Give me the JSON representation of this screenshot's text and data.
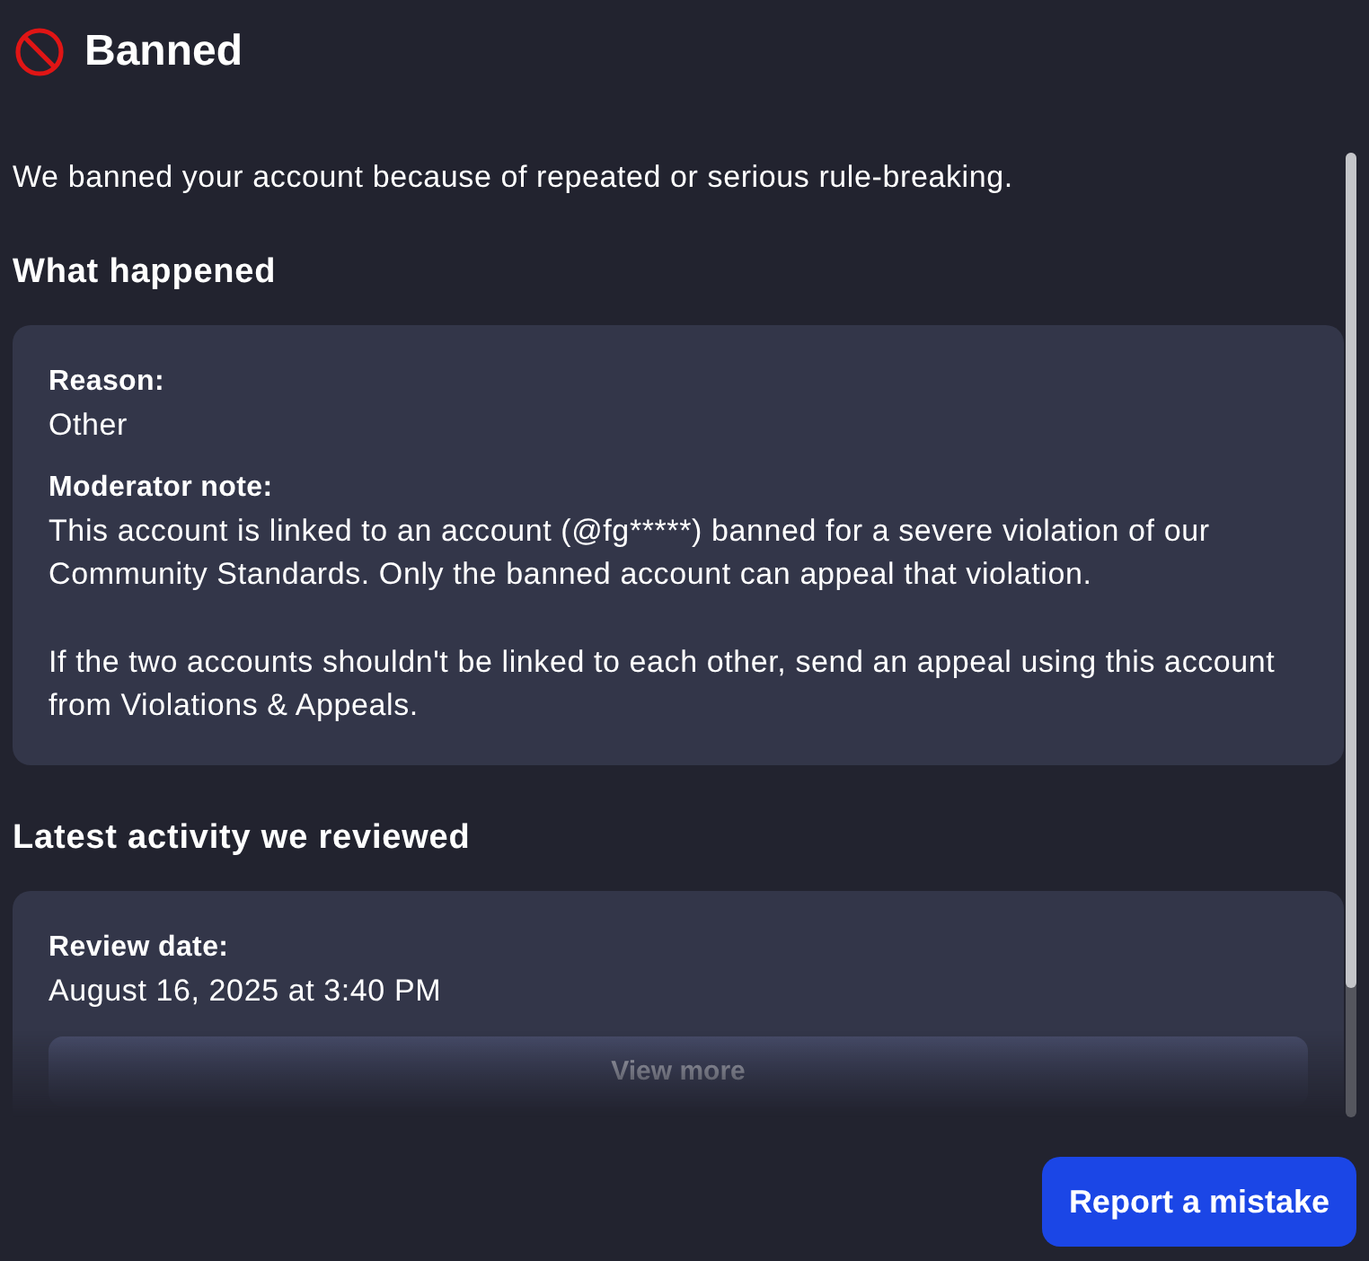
{
  "header": {
    "title": "Banned"
  },
  "summary": "We banned your account because of repeated or serious rule-breaking.",
  "sections": [
    {
      "heading": "What happened",
      "fields": [
        {
          "label": "Reason:",
          "paragraphs": [
            "Other"
          ]
        },
        {
          "label": "Moderator note:",
          "paragraphs": [
            "This account is linked to an account (@fg*****) banned for a severe violation of our Community Standards. Only the banned account can appeal that violation.",
            "If the two accounts shouldn't be linked to each other, send an appeal using this account from Violations & Appeals."
          ]
        }
      ]
    },
    {
      "heading": "Latest activity we reviewed",
      "fields": [
        {
          "label": "Review date:",
          "paragraphs": [
            "August 16, 2025 at 3:40 PM"
          ]
        }
      ],
      "button": "View more"
    }
  ],
  "footer": {
    "button": "Report a mistake"
  }
}
